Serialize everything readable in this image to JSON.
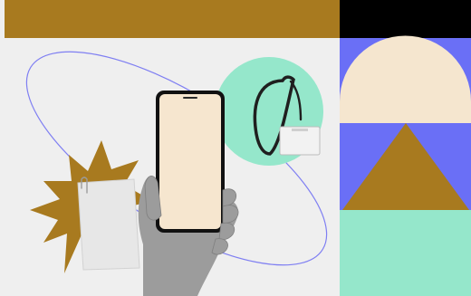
{
  "colors": {
    "background": "#efefef",
    "gold": "#a87a1f",
    "black": "#000000",
    "blue": "#6a6ff6",
    "cream": "#f5e6cf",
    "mint": "#95e7cb",
    "phone_body": "#111111",
    "phone_screen": "#f6e6cf",
    "ellipse_stroke": "#7f7ff2",
    "paper": "#e7e7e7",
    "hand": "#9c9c9c",
    "badge": "#f2f2f2",
    "lanyard": "#1f1f1f"
  },
  "icons": {
    "starburst": "starburst-icon",
    "paper_note": "paper-note-icon",
    "phone": "smartphone-icon",
    "hand": "hand-icon",
    "lanyard": "lanyard-badge-icon"
  }
}
